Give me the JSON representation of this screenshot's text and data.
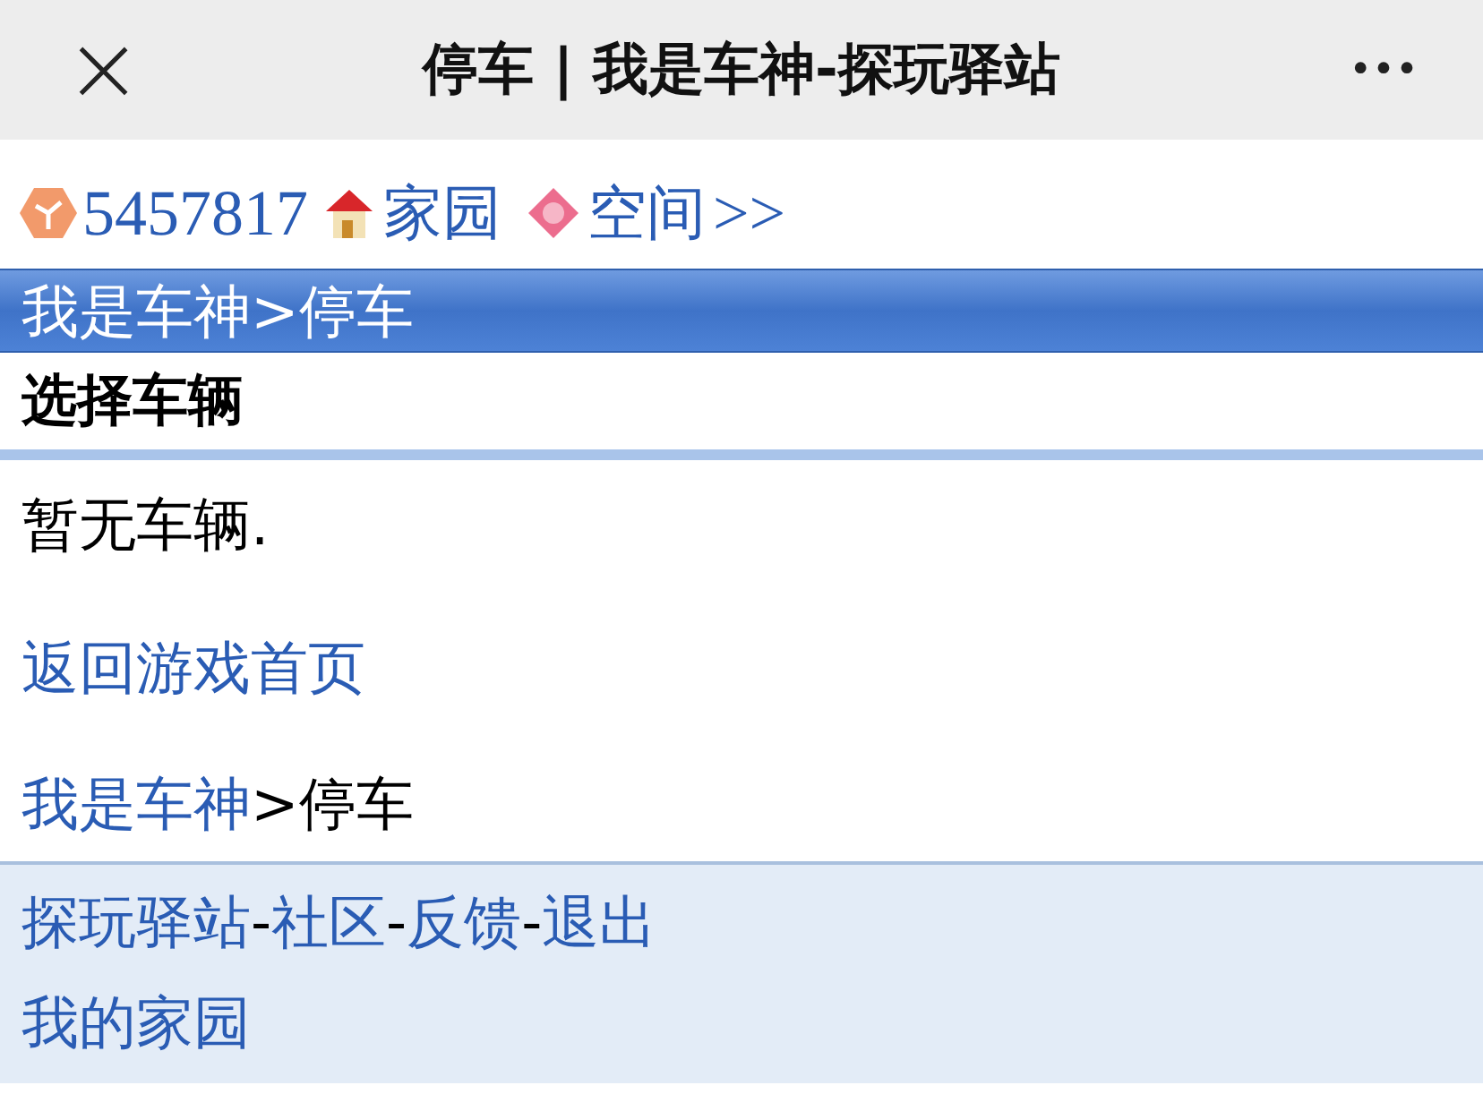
{
  "nav_bar": {
    "close": "×",
    "title": "停车 | 我是车神-探玩驿站",
    "more": "•••"
  },
  "top_links": [
    {
      "kind": "id",
      "text": "5457817"
    },
    {
      "kind": "home",
      "text": "家园"
    },
    {
      "kind": "space",
      "text": "空间"
    },
    {
      "kind": "more",
      "text": ">>"
    }
  ],
  "title_bar": "我是车神>停车",
  "section_title": "选择车辆",
  "message": "暂无车辆.",
  "back_link": "返回游戏首页",
  "breadcrumb": [
    {
      "kind": "link",
      "text": "我是车神"
    },
    {
      "kind": "plain",
      "text": ">停车"
    }
  ],
  "footer_lines": [
    [
      {
        "kind": "link",
        "text": "探玩驿站"
      },
      {
        "kind": "plain",
        "text": "-"
      },
      {
        "kind": "link",
        "text": "社区"
      },
      {
        "kind": "plain",
        "text": "-"
      },
      {
        "kind": "link",
        "text": "反馈"
      },
      {
        "kind": "plain",
        "text": "-"
      },
      {
        "kind": "link",
        "text": "退出"
      }
    ],
    [
      {
        "kind": "link",
        "text": "我的家园"
      }
    ]
  ]
}
